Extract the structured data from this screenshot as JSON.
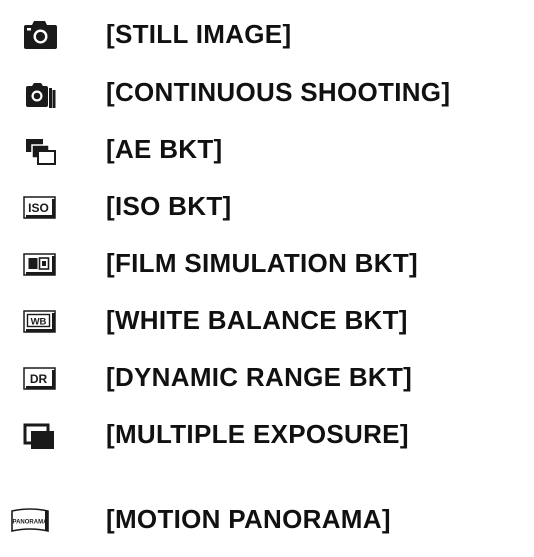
{
  "modes": [
    {
      "icon": "camera-icon",
      "label": "[STILL IMAGE]"
    },
    {
      "icon": "continuous-shooting-icon",
      "label": "[CONTINUOUS SHOOTING]"
    },
    {
      "icon": "ae-bracketing-icon",
      "label": "[AE BKT]"
    },
    {
      "icon": "iso-bracketing-icon",
      "label": "[ISO BKT]",
      "icon_text": "ISO"
    },
    {
      "icon": "film-simulation-bracketing-icon",
      "label": "[FILM SIMULATION BKT]"
    },
    {
      "icon": "white-balance-bracketing-icon",
      "label": "[WHITE BALANCE BKT]",
      "icon_text": "WB"
    },
    {
      "icon": "dynamic-range-bracketing-icon",
      "label": "[DYNAMIC RANGE BKT]",
      "icon_text": "DR"
    },
    {
      "icon": "multiple-exposure-icon",
      "label": "[MULTIPLE EXPOSURE]"
    },
    {
      "icon": "motion-panorama-icon",
      "label": "[MOTION PANORAMA]",
      "icon_text": "PANORAMA"
    }
  ],
  "colors": {
    "text": "#111111",
    "icon": "#1a1a1a",
    "background": "#ffffff"
  }
}
